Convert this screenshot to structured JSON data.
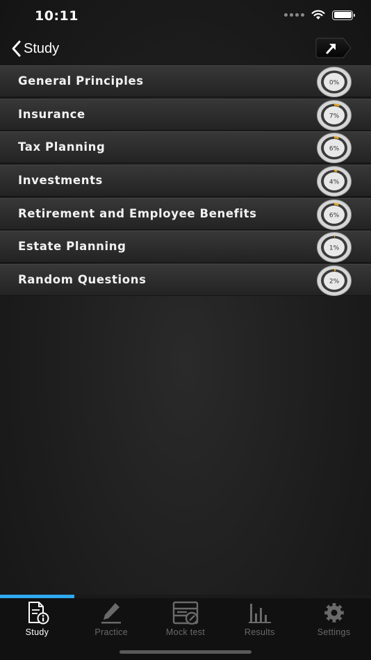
{
  "status_bar": {
    "time": "10:11"
  },
  "nav": {
    "back_label": "Study",
    "share_icon": "arrow-up-right-icon"
  },
  "topics": [
    {
      "label": "General Principles",
      "progress_label": "0%",
      "progress": 0
    },
    {
      "label": "Insurance",
      "progress_label": "7%",
      "progress": 7
    },
    {
      "label": "Tax Planning",
      "progress_label": "6%",
      "progress": 6
    },
    {
      "label": "Investments",
      "progress_label": "4%",
      "progress": 4
    },
    {
      "label": "Retirement and Employee Benefits",
      "progress_label": "6%",
      "progress": 6
    },
    {
      "label": "Estate Planning",
      "progress_label": "1%",
      "progress": 1
    },
    {
      "label": "Random Questions",
      "progress_label": "2%",
      "progress": 2
    }
  ],
  "tabs": [
    {
      "label": "Study",
      "icon": "study-document-icon",
      "active": true
    },
    {
      "label": "Practice",
      "icon": "pencil-icon",
      "active": false
    },
    {
      "label": "Mock test",
      "icon": "mock-test-icon",
      "active": false
    },
    {
      "label": "Results",
      "icon": "bar-chart-icon",
      "active": false
    },
    {
      "label": "Settings",
      "icon": "gear-icon",
      "active": false
    }
  ],
  "colors": {
    "accent": "#2eaaf0",
    "progress_arc": "#e0a21c",
    "active_tab": "#ffffff",
    "inactive_tab": "#6a6a6a"
  }
}
